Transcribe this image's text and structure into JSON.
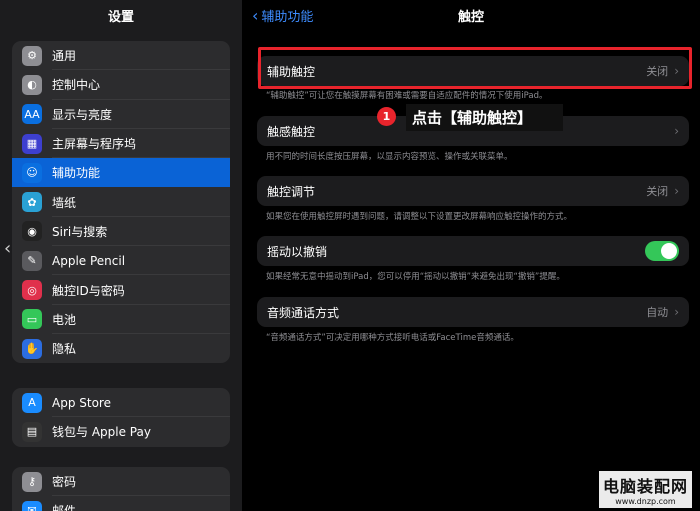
{
  "sidebar": {
    "title": "设置",
    "group1": [
      {
        "label": "通用",
        "icon": "gear-icon",
        "color": "#8e8e93",
        "glyph": "⚙"
      },
      {
        "label": "控制中心",
        "icon": "toggles-icon",
        "color": "#8e8e93",
        "glyph": "◐"
      },
      {
        "label": "显示与亮度",
        "icon": "text-size-icon",
        "color": "#0a6fe0",
        "glyph": "AA"
      },
      {
        "label": "主屏幕与程序坞",
        "icon": "home-grid-icon",
        "color": "#3d3fcf",
        "glyph": "▦"
      },
      {
        "label": "辅助功能",
        "icon": "accessibility-icon",
        "color": "#0a6fe0",
        "glyph": "☺"
      },
      {
        "label": "墙纸",
        "icon": "wallpaper-flower-icon",
        "color": "#2aa1d4",
        "glyph": "✿"
      },
      {
        "label": "Siri与搜索",
        "icon": "siri-icon",
        "color": "#222222",
        "glyph": "◉"
      },
      {
        "label": "Apple Pencil",
        "icon": "pencil-icon",
        "color": "#5a5a5e",
        "glyph": "✎"
      },
      {
        "label": "触控ID与密码",
        "icon": "fingerprint-icon",
        "color": "#e0304c",
        "glyph": "◎"
      },
      {
        "label": "电池",
        "icon": "battery-icon",
        "color": "#34c759",
        "glyph": "▭"
      },
      {
        "label": "隐私",
        "icon": "hand-icon",
        "color": "#2c6de0",
        "glyph": "✋"
      }
    ],
    "group2": [
      {
        "label": "App Store",
        "icon": "app-store-icon",
        "color": "#1a8cff",
        "glyph": "A"
      },
      {
        "label": "钱包与 Apple Pay",
        "icon": "wallet-icon",
        "color": "#333333",
        "glyph": "▤"
      }
    ],
    "group3": [
      {
        "label": "密码",
        "icon": "key-icon",
        "color": "#8e8e93",
        "glyph": "⚷"
      },
      {
        "label": "邮件",
        "icon": "mail-icon",
        "color": "#1a8cff",
        "glyph": "✉"
      }
    ],
    "selected": "辅助功能"
  },
  "nav": {
    "back_label": "辅助功能",
    "title": "触控"
  },
  "rows": [
    {
      "label": "辅助触控",
      "value": "关闭",
      "footer": "“辅助触控”可让您在触摸屏幕有困难或需要自适应配件的情况下使用iPad。"
    },
    {
      "label": "触感触控",
      "value": "",
      "footer": "用不同的时间长度按压屏幕，以显示内容预览、操作或关联菜单。"
    },
    {
      "label": "触控调节",
      "value": "关闭",
      "footer": "如果您在使用触控屏时遇到问题，请调整以下设置更改屏幕响应触控操作的方式。"
    },
    {
      "label": "摇动以撤销",
      "toggle": true,
      "footer": "如果经常无意中摇动到iPad，您可以停用“摇动以撤销”来避免出现“撤销”提醒。"
    },
    {
      "label": "音频通话方式",
      "value": "自动",
      "footer": "“音频通话方式”可决定用哪种方式接听电话或FaceTime音频通话。"
    }
  ],
  "annotation": {
    "badge": "1",
    "text": "点击【辅助触控】",
    "highlight_color": "#e8242c"
  },
  "watermark": {
    "line1": "电脑装配网",
    "line2": "www.dnzp.com"
  }
}
